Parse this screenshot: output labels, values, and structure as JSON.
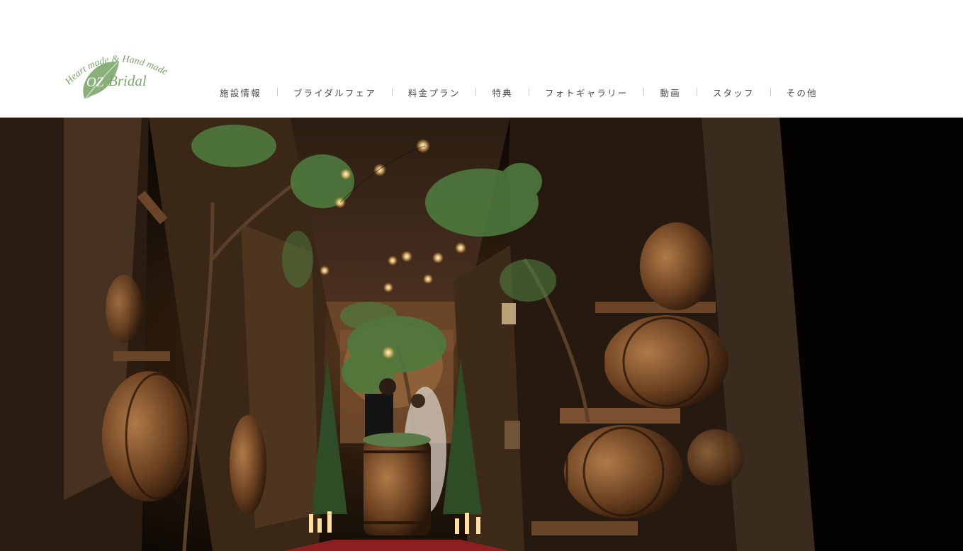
{
  "brand": {
    "tagline": "Heart made & Hand made",
    "name_oz": "OZ",
    "name_bridal": "Bridal",
    "leaf_color": "#8ab07a",
    "text_color": "#7aa86a"
  },
  "nav": {
    "items": [
      {
        "label": "施設情報"
      },
      {
        "label": "ブライダルフェア"
      },
      {
        "label": "料金プラン"
      },
      {
        "label": "特典"
      },
      {
        "label": "フォトギャラリー"
      },
      {
        "label": "動画"
      },
      {
        "label": "スタッフ"
      },
      {
        "label": "その他"
      }
    ]
  },
  "hero": {
    "scene": "wine-cellar-wedding-photo",
    "palette": {
      "dark": "#120c07",
      "wood": "#7a4a26",
      "barrel": "#8a5a32",
      "greenery": "#4f7a3e",
      "light": "#ffe8b0",
      "carpet": "#8c1f1f"
    }
  }
}
